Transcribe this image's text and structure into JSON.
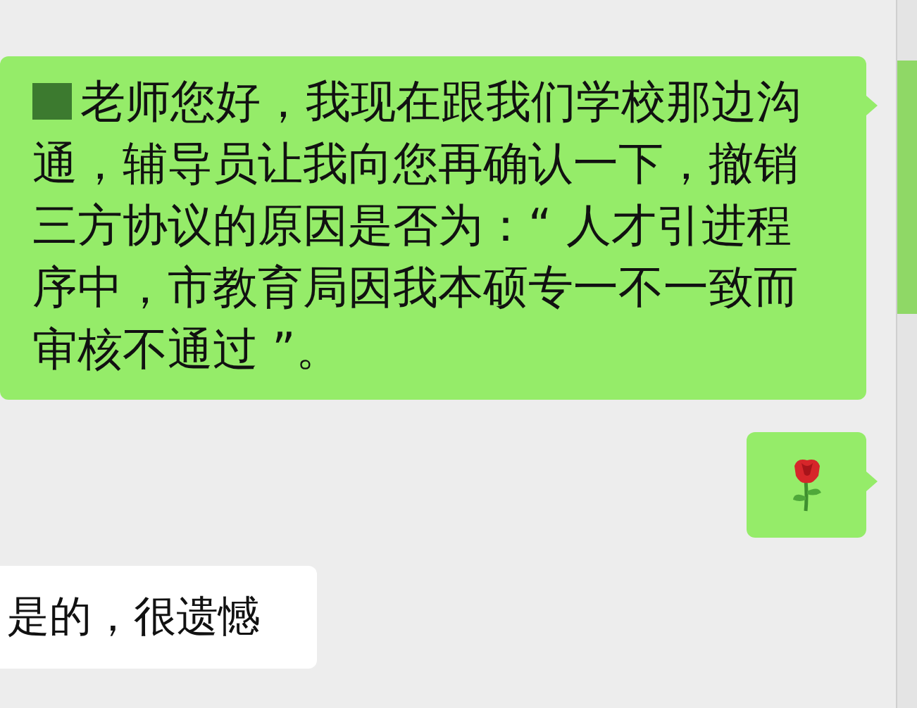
{
  "messages": [
    {
      "outgoing": true,
      "kind": "text",
      "redacted": true,
      "text": "老师您好，我现在跟我们学校那边沟通，辅导员让我向您再确认一下，撤销三方协议的原因是否为：“ 人才引进程序中，市教育局因我本硕专一不一致而审核不通过 ”。"
    },
    {
      "outgoing": true,
      "kind": "emoji"
    },
    {
      "outgoing": false,
      "kind": "text",
      "redacted": false,
      "text": "是的，很遗憾"
    }
  ]
}
